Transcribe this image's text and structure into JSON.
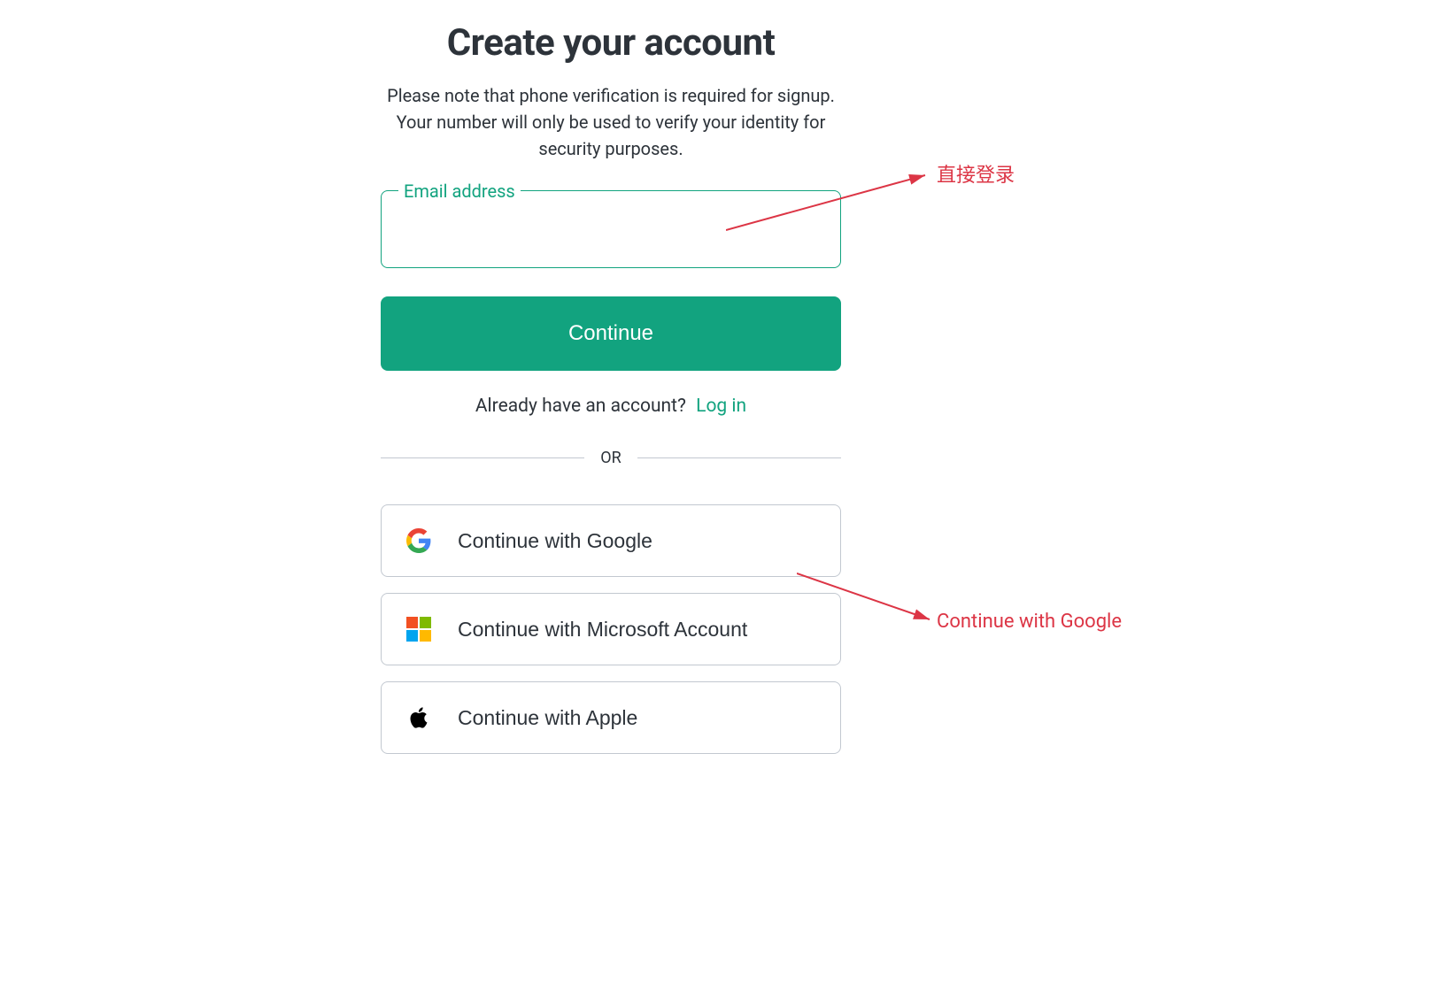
{
  "heading": "Create your account",
  "subtitle": "Please note that phone verification is required for signup. Your number will only be used to verify your identity for security purposes.",
  "email": {
    "label": "Email address",
    "value": ""
  },
  "continue_label": "Continue",
  "login_prompt": "Already have an account?",
  "login_link": "Log in",
  "or_text": "OR",
  "social": {
    "google": "Continue with Google",
    "microsoft": "Continue with Microsoft Account",
    "apple": "Continue with Apple"
  },
  "annotations": {
    "a1": "直接登录",
    "a2": "Continue with Google"
  }
}
